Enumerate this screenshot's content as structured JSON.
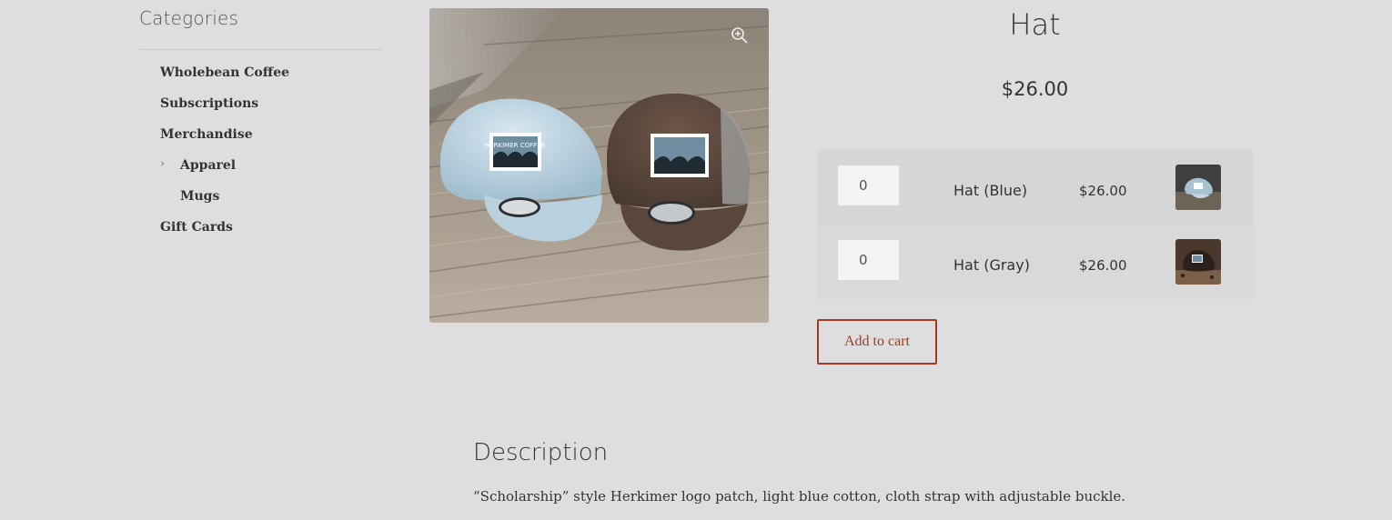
{
  "sidebar": {
    "title": "Categories",
    "items": [
      {
        "label": "Wholebean Coffee"
      },
      {
        "label": "Subscriptions"
      },
      {
        "label": "Merchandise"
      },
      {
        "label": "Apparel"
      },
      {
        "label": "Mugs"
      },
      {
        "label": "Gift Cards"
      }
    ]
  },
  "product": {
    "title": "Hat",
    "price": "$26.00",
    "image_alt": "Two baseball caps with Herkimer Coffee patches on a wooden deck",
    "image_logo_text": "HERKIMER COFFEE",
    "variants": [
      {
        "qty": "0",
        "name": "Hat (Blue)",
        "price": "$26.00"
      },
      {
        "qty": "0",
        "name": "Hat (Gray)",
        "price": "$26.00"
      }
    ],
    "add_to_cart_label": "Add to cart"
  },
  "description": {
    "heading": "Description",
    "text": "“Scholarship” style Herkimer logo patch, light blue cotton, cloth strap with adjustable buckle."
  },
  "icons": {
    "zoom": "zoom-in-icon",
    "chevron": "chevron-right-icon"
  },
  "colors": {
    "background": "#dedede",
    "accent": "#a23a22"
  }
}
